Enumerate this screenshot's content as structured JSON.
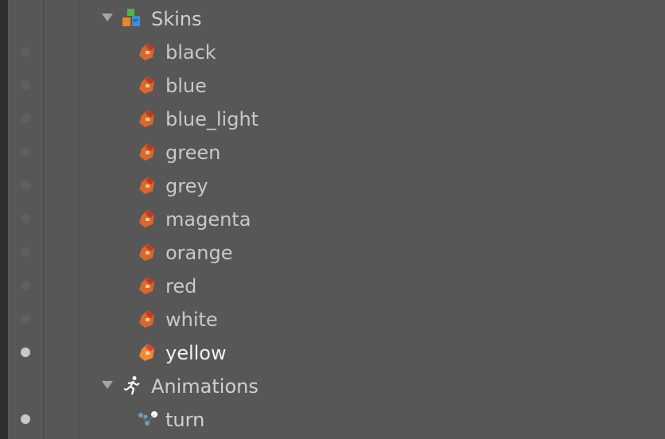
{
  "tree": {
    "skins_group": {
      "label": "Skins",
      "icon": "skins-icon",
      "expanded": true
    },
    "skins": [
      {
        "label": "black",
        "icon": "skin-icon",
        "visible": false
      },
      {
        "label": "blue",
        "icon": "skin-icon",
        "visible": false
      },
      {
        "label": "blue_light",
        "icon": "skin-icon",
        "visible": false
      },
      {
        "label": "green",
        "icon": "skin-icon",
        "visible": false
      },
      {
        "label": "grey",
        "icon": "skin-icon",
        "visible": false
      },
      {
        "label": "magenta",
        "icon": "skin-icon",
        "visible": false
      },
      {
        "label": "orange",
        "icon": "skin-icon",
        "visible": false
      },
      {
        "label": "red",
        "icon": "skin-icon",
        "visible": false
      },
      {
        "label": "white",
        "icon": "skin-icon",
        "visible": false
      },
      {
        "label": "yellow",
        "icon": "skin-icon",
        "visible": true,
        "active": true
      }
    ],
    "animations_group": {
      "label": "Animations",
      "icon": "animations-icon",
      "expanded": true
    },
    "animations": [
      {
        "label": "turn",
        "icon": "animation-icon",
        "visible": true
      }
    ]
  },
  "colors": {
    "background": "#575757",
    "text": "#d0d0d0",
    "active_text": "#f0f0f0",
    "visible_dot": "#c9c9c9",
    "hidden_dot": "#5f5f5f"
  }
}
